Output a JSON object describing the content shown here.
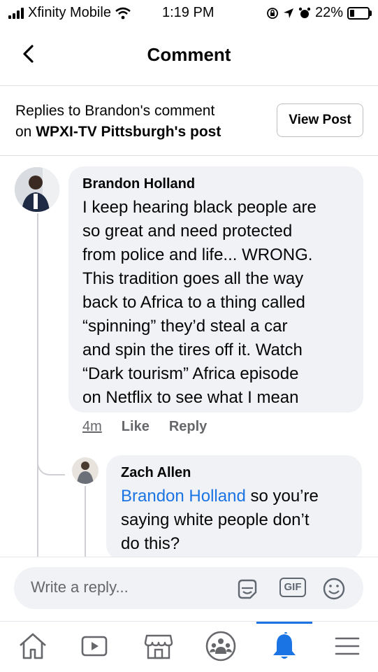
{
  "status_bar": {
    "carrier": "Xfinity Mobile",
    "time": "1:19 PM",
    "battery": "22%"
  },
  "nav": {
    "title": "Comment"
  },
  "context": {
    "prefix": "Replies to Brandon's comment",
    "on": "on",
    "page": "WPXI-TV Pittsburgh's post",
    "view_post": "View Post"
  },
  "comment": {
    "author": "Brandon Holland",
    "lines": [
      "I keep hearing black people are",
      "so great and need protected",
      "from police and life... WRONG.",
      "This tradition goes all the way",
      "back to Africa to a thing called",
      "“spinning” they’d steal a car",
      "and spin the tires off it. Watch",
      "“Dark tourism” Africa episode",
      "on Netflix to see what I mean"
    ],
    "time": "4m",
    "like": "Like",
    "reply": "Reply"
  },
  "reply": {
    "author": "Zach Allen",
    "mention": "Brandon Holland",
    "line1_rest": " so you’re",
    "line2": "saying white people don’t",
    "line3": "do this?"
  },
  "composer": {
    "placeholder": "Write a reply...",
    "gif": "GIF"
  },
  "tabs": [
    "home",
    "watch",
    "marketplace",
    "groups",
    "notifications",
    "menu"
  ],
  "colors": {
    "accent": "#1b74e4",
    "bubble": "#f0f2f5"
  }
}
